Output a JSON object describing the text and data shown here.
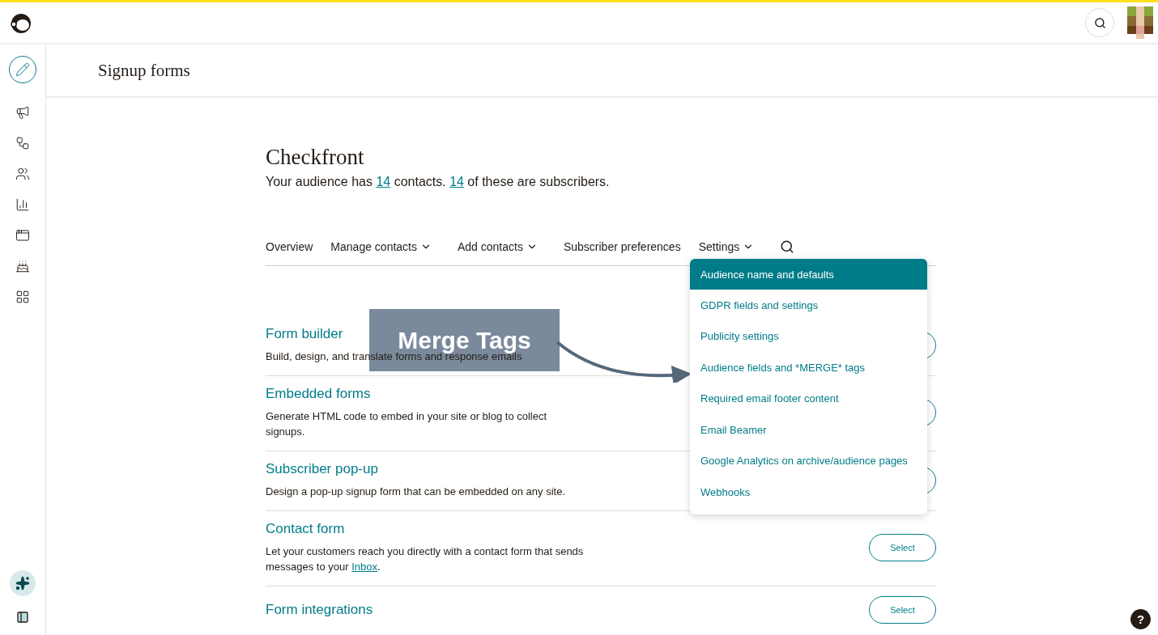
{
  "page_title": "Signup forms",
  "sidebar": {
    "items": [
      {
        "selected": true
      },
      {
        "selected": false
      },
      {
        "selected": false
      },
      {
        "selected": false
      },
      {
        "selected": false
      },
      {
        "selected": false
      },
      {
        "selected": false
      },
      {
        "selected": false
      }
    ]
  },
  "audience": {
    "name": "Checkfront",
    "summary": [
      {
        "text": "Your audience has ",
        "link": false
      },
      {
        "text": "14",
        "link": true
      },
      {
        "text": " contacts. ",
        "link": false
      },
      {
        "text": "14",
        "link": true
      },
      {
        "text": " of these are subscribers.",
        "link": false
      }
    ]
  },
  "nav": [
    {
      "label": "Overview",
      "dropdown": false
    },
    {
      "label": "Manage contacts",
      "dropdown": true
    },
    {
      "label": "Add contacts",
      "dropdown": true
    },
    {
      "label": "Subscriber preferences",
      "dropdown": false
    },
    {
      "label": "Settings",
      "dropdown": true
    }
  ],
  "settings_menu": [
    {
      "label": "Audience name and defaults",
      "selected": true
    },
    {
      "label": "GDPR fields and settings",
      "selected": false
    },
    {
      "label": "Publicity settings",
      "selected": false
    },
    {
      "label": "Audience fields and *MERGE* tags",
      "selected": false
    },
    {
      "label": "Required email footer content",
      "selected": false
    },
    {
      "label": "Email Beamer",
      "selected": false
    },
    {
      "label": "Google Analytics on archive/audience pages",
      "selected": false
    },
    {
      "label": "Webhooks",
      "selected": false
    }
  ],
  "forms": [
    {
      "title": "Form builder",
      "description": [
        {
          "text": "Build, design, and translate forms and response emails",
          "link": false
        }
      ]
    },
    {
      "title": "Embedded forms",
      "description": [
        {
          "text": "Generate HTML code to embed in your site or blog to collect signups.",
          "link": false
        }
      ]
    },
    {
      "title": "Subscriber pop-up",
      "description": [
        {
          "text": "Design a pop-up signup form that can be embedded on any site.",
          "link": false
        }
      ]
    },
    {
      "title": "Contact form",
      "description": [
        {
          "text": "Let your customers reach you directly with a contact form that sends messages to your ",
          "link": false
        },
        {
          "text": "Inbox",
          "link": true
        },
        {
          "text": ".",
          "link": false
        }
      ],
      "button": "Select"
    },
    {
      "title": "Form integrations",
      "button": "Select"
    }
  ],
  "callout": {
    "label": "Merge Tags"
  },
  "help": {
    "label": "?"
  }
}
